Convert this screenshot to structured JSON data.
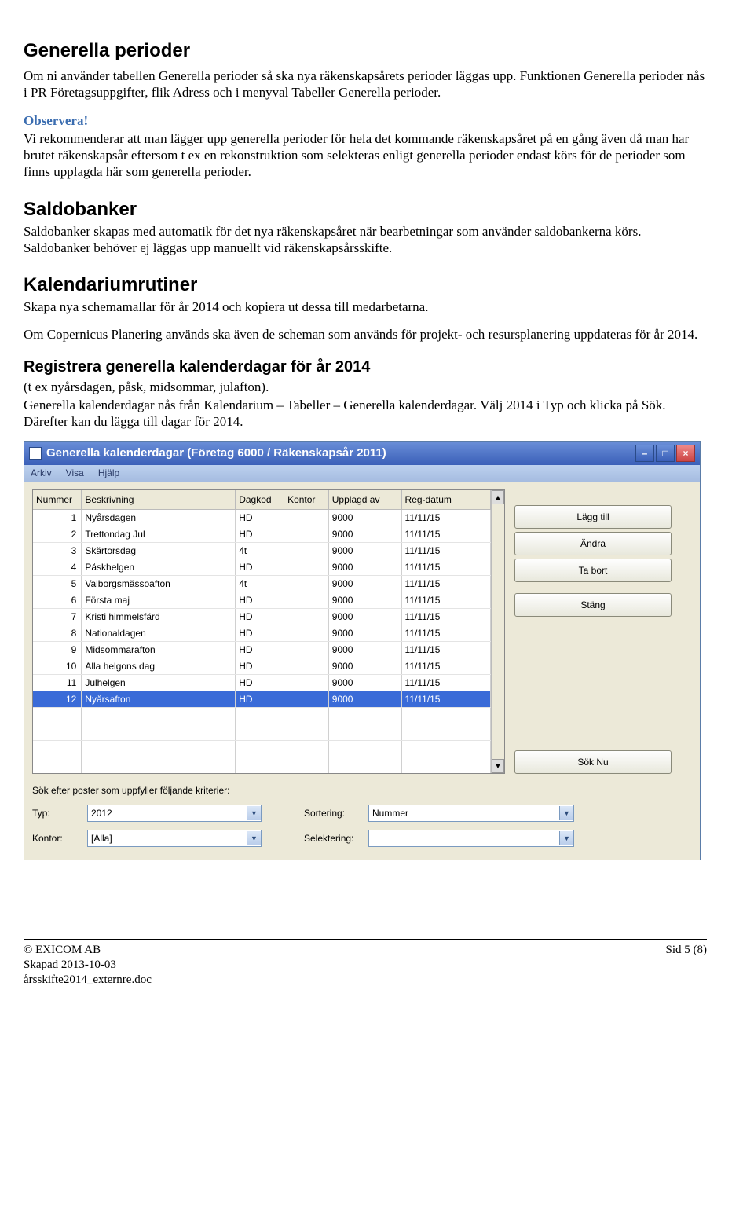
{
  "doc": {
    "h1": "Generella perioder",
    "p1": "Om ni använder tabellen Generella perioder så ska nya räkenskapsårets perioder läggas upp. Funktionen Generella perioder nås i PR Företagsuppgifter, flik Adress och i menyval Tabeller Generella perioder.",
    "obs_title": "Observera!",
    "obs_text": "Vi rekommenderar att man lägger upp generella perioder för hela det kommande räkenskapsåret på en gång även då man har brutet räkenskapsår eftersom t ex en rekonstruktion som selekteras enligt generella perioder endast körs för de perioder som finns upplagda här som generella perioder.",
    "h2a": "Saldobanker",
    "p2": "Saldobanker skapas med automatik för det nya räkenskapsåret när bearbetningar som använder saldobankerna körs. Saldobanker behöver ej läggas upp manuellt vid räkenskapsårsskifte.",
    "h2b": "Kalendariumrutiner",
    "p3": "Skapa nya schemamallar för år 2014 och kopiera ut dessa till medarbetarna.",
    "p4": "Om Copernicus Planering används ska även de scheman som används för projekt- och resursplanering uppdateras för år 2014.",
    "h3": "Registrera generella kalenderdagar för år 2014",
    "p5a": "(t ex nyårsdagen, påsk, midsommar, julafton).",
    "p5b": "Generella kalenderdagar nås från Kalendarium – Tabeller – Generella kalenderdagar. Välj 2014 i Typ och klicka på Sök. Därefter kan du lägga till dagar för 2014."
  },
  "app": {
    "title": "Generella kalenderdagar (Företag 6000 / Räkenskapsår 2011)",
    "menu": {
      "arkiv": "Arkiv",
      "visa": "Visa",
      "hjalp": "Hjälp"
    },
    "columns": {
      "nummer": "Nummer",
      "beskrivning": "Beskrivning",
      "dagkod": "Dagkod",
      "kontor": "Kontor",
      "upplagd": "Upplagd av",
      "regdatum": "Reg-datum"
    },
    "rows": [
      {
        "n": "1",
        "b": "Nyårsdagen",
        "d": "HD",
        "k": "",
        "u": "9000",
        "r": "11/11/15"
      },
      {
        "n": "2",
        "b": "Trettondag Jul",
        "d": "HD",
        "k": "",
        "u": "9000",
        "r": "11/11/15"
      },
      {
        "n": "3",
        "b": "Skärtorsdag",
        "d": "4t",
        "k": "",
        "u": "9000",
        "r": "11/11/15"
      },
      {
        "n": "4",
        "b": "Påskhelgen",
        "d": "HD",
        "k": "",
        "u": "9000",
        "r": "11/11/15"
      },
      {
        "n": "5",
        "b": "Valborgsmässoafton",
        "d": "4t",
        "k": "",
        "u": "9000",
        "r": "11/11/15"
      },
      {
        "n": "6",
        "b": "Första maj",
        "d": "HD",
        "k": "",
        "u": "9000",
        "r": "11/11/15"
      },
      {
        "n": "7",
        "b": "Kristi himmelsfärd",
        "d": "HD",
        "k": "",
        "u": "9000",
        "r": "11/11/15"
      },
      {
        "n": "8",
        "b": "Nationaldagen",
        "d": "HD",
        "k": "",
        "u": "9000",
        "r": "11/11/15"
      },
      {
        "n": "9",
        "b": "Midsommarafton",
        "d": "HD",
        "k": "",
        "u": "9000",
        "r": "11/11/15"
      },
      {
        "n": "10",
        "b": "Alla helgons dag",
        "d": "HD",
        "k": "",
        "u": "9000",
        "r": "11/11/15"
      },
      {
        "n": "11",
        "b": "Julhelgen",
        "d": "HD",
        "k": "",
        "u": "9000",
        "r": "11/11/15"
      },
      {
        "n": "12",
        "b": "Nyårsafton",
        "d": "HD",
        "k": "",
        "u": "9000",
        "r": "11/11/15"
      }
    ],
    "buttons": {
      "add": "Lägg till",
      "edit": "Ändra",
      "del": "Ta bort",
      "close": "Stäng",
      "search": "Sök Nu"
    },
    "search": {
      "intro": "Sök efter poster som uppfyller följande kriterier:",
      "typ_label": "Typ:",
      "typ_value": "2012",
      "sort_label": "Sortering:",
      "sort_value": "Nummer",
      "kontor_label": "Kontor:",
      "kontor_value": "[Alla]",
      "sel_label": "Selektering:",
      "sel_value": ""
    }
  },
  "footer": {
    "copyright": "© EXICOM AB",
    "created": "Skapad 2013-10-03",
    "filename": "årsskifte2014_externre.doc",
    "page": "Sid 5 (8)"
  }
}
